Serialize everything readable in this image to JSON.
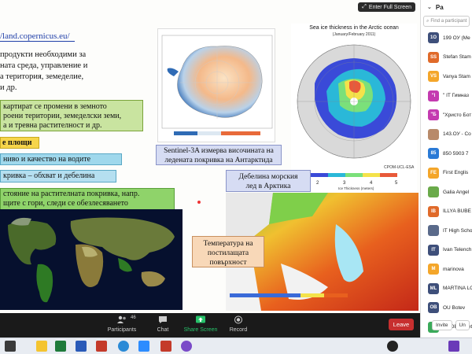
{
  "share": {
    "fullscreen_label": "Enter Full Screen",
    "link_text": "/land.copernicus.eu/",
    "paragraph": [
      "продукти необходими за",
      "ната среда, управление и",
      "а територия, земеделие,",
      "и др."
    ],
    "box1": [
      "картират се промени в земното",
      "роени територии, земеделски земи,",
      "а и тревна растителност и др."
    ],
    "box2": "е площи",
    "box3": "ниво и качество на водите",
    "box4": "кривка – обхват и дебелина",
    "box5": [
      "стояние на растителната покривка, напр.",
      "щите с гори, следи се обезлесяването"
    ],
    "cap_antarctic": [
      "Sentinel-3A измерва височината на",
      "ледената покривка на Антарктида"
    ],
    "arctic_title": "Sea ice thickness in the Arctic ocean",
    "arctic_sub": "(January/February 2011)",
    "arctic_credit": "CPOM-UCL-ESA",
    "arctic_scale": [
      "2",
      "3",
      "4",
      "5"
    ],
    "arctic_scale_label": "Ice Thickness (meters)",
    "cap_arctic": [
      "Дебелина морския",
      "лед в Арктика"
    ],
    "cap_temp": [
      "Температура на",
      "постилащата",
      "повърхност"
    ]
  },
  "toolbar": {
    "participants_count": "46",
    "items": [
      "Participants",
      "Chat",
      "Share Screen",
      "Record"
    ],
    "leave": "Leave",
    "share_color": "#27c26a"
  },
  "panel": {
    "title": "Pa",
    "search_placeholder": "Find a participant",
    "participants": [
      {
        "initials": "1O",
        "name": "199 ОУ (Ме",
        "color": "#3e4f7a"
      },
      {
        "initials": "SS",
        "name": "Stefan Stam",
        "color": "#e06a2a"
      },
      {
        "initials": "VS",
        "name": "Vanya Stam",
        "color": "#f4a62a"
      },
      {
        "initials": "\"I",
        "name": "\" IT Гимназ",
        "color": "#c43ab0"
      },
      {
        "initials": "\"Б",
        "name": "\"Христо Бот",
        "color": "#c43ab0"
      },
      {
        "initials": "",
        "name": "143.ОУ - Со",
        "color": "#b88a6a"
      },
      {
        "initials": "85",
        "name": "850 5903 7",
        "color": "#2a7ad6"
      },
      {
        "initials": "FE",
        "name": "First Englis",
        "color": "#f4a62a"
      },
      {
        "initials": "",
        "name": "Galia Angel",
        "color": "#6aaa4a"
      },
      {
        "initials": "IB",
        "name": "ILLYA BUBE",
        "color": "#e06a2a"
      },
      {
        "initials": "",
        "name": "IT High Scho",
        "color": "#5a6a8a"
      },
      {
        "initials": "IT",
        "name": "Ivan Telench",
        "color": "#3e4f7a"
      },
      {
        "initials": "M",
        "name": "marinova",
        "color": "#f4a62a"
      },
      {
        "initials": "ML",
        "name": "MARTINA LO",
        "color": "#3e4f7a"
      },
      {
        "initials": "OB",
        "name": "OU Botev",
        "color": "#3e4f7a"
      },
      {
        "initials": "P",
        "name": "PGOElisavet",
        "color": "#3aaa5a"
      }
    ],
    "invite": "Invite",
    "unmute": "Un"
  }
}
